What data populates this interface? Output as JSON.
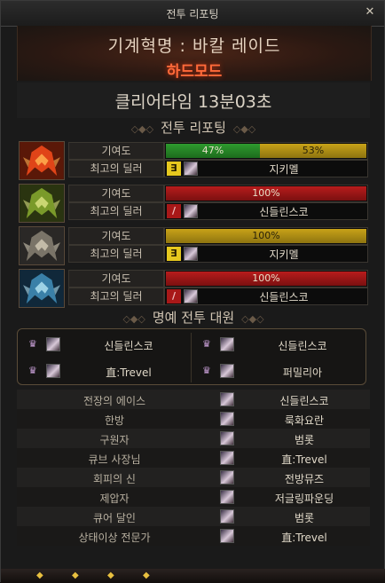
{
  "window": {
    "title": "전투 리포팅",
    "close_icon": "close-icon"
  },
  "raid": {
    "name": "기계혁명 : 바칼 레이드",
    "difficulty": "하드모드"
  },
  "clear_time": "클리어타임  13분03초",
  "sections": {
    "report": "전투 리포팅",
    "honor": "명예 전투 대원"
  },
  "labels": {
    "contribution": "기여도",
    "best_dealer": "최고의 딜러"
  },
  "bosses": [
    {
      "icon": "fire-dragon-helmet-icon",
      "contribution": [
        {
          "value": "47%",
          "fraction": 0.47,
          "color": "green"
        },
        {
          "value": "53%",
          "fraction": 0.53,
          "color": "gold"
        }
      ],
      "dealer": {
        "class_glyph": "∃",
        "class_color": "yellow",
        "name": "지키멜"
      }
    },
    {
      "icon": "earth-dragon-helmet-icon",
      "contribution": [
        {
          "value": "100%",
          "fraction": 1.0,
          "color": "red"
        }
      ],
      "dealer": {
        "class_glyph": "/",
        "class_color": "red",
        "name": "신들린스코"
      }
    },
    {
      "icon": "steel-dragon-helmet-icon",
      "contribution": [
        {
          "value": "100%",
          "fraction": 1.0,
          "color": "gold"
        }
      ],
      "dealer": {
        "class_glyph": "∃",
        "class_color": "yellow",
        "name": "지키멜"
      }
    },
    {
      "icon": "ice-dragon-helmet-icon",
      "contribution": [
        {
          "value": "100%",
          "fraction": 1.0,
          "color": "red"
        }
      ],
      "dealer": {
        "class_glyph": "/",
        "class_color": "red",
        "name": "신들린스코"
      }
    }
  ],
  "honor_members": [
    {
      "name": "신들린스코"
    },
    {
      "name": "신들린스코"
    },
    {
      "name": "直:Trevel"
    },
    {
      "name": "퍼밀리아"
    }
  ],
  "awards": [
    {
      "title": "전장의 에이스",
      "name": "신들린스코"
    },
    {
      "title": "한방",
      "name": "룩화요란"
    },
    {
      "title": "구원자",
      "name": "범롯"
    },
    {
      "title": "큐브 사장님",
      "name": "直:Trevel"
    },
    {
      "title": "회피의 신",
      "name": "전방뮤즈"
    },
    {
      "title": "제압자",
      "name": "저글링파운딩"
    },
    {
      "title": "큐어 달인",
      "name": "범롯"
    },
    {
      "title": "상태이상 전문가",
      "name": "直:Trevel"
    }
  ],
  "colors": {
    "accent_difficulty": "#ff6a3a",
    "bar_green": "#2e9a2e",
    "bar_gold": "#c8a218",
    "bar_red": "#b81c1c"
  }
}
